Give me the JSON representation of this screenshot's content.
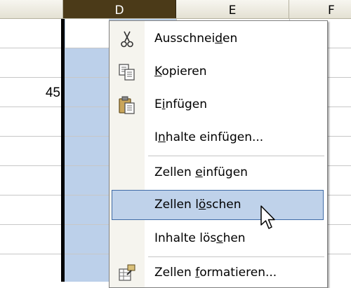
{
  "columns": [
    {
      "id": "c",
      "label": ""
    },
    {
      "id": "d",
      "label": "D"
    },
    {
      "id": "e",
      "label": "E"
    },
    {
      "id": "f",
      "label": "F"
    }
  ],
  "cell_value": "45",
  "menu": {
    "items": [
      {
        "pre": "Ausschnei",
        "key": "d",
        "post": "en",
        "icon": "scissors-icon"
      },
      {
        "pre": "",
        "key": "K",
        "post": "opieren",
        "icon": "copy-icon"
      },
      {
        "pre": "E",
        "key": "i",
        "post": "nfügen",
        "icon": "paste-icon"
      },
      {
        "pre": "I",
        "key": "n",
        "post": "halte einfügen...",
        "icon": ""
      },
      {
        "pre": "Zellen ",
        "key": "e",
        "post": "infügen",
        "icon": ""
      },
      {
        "pre": "Zellen l",
        "key": "ö",
        "post": "schen",
        "icon": "",
        "highlighted": true
      },
      {
        "pre": "Inhalte lös",
        "key": "c",
        "post": "hen",
        "icon": ""
      },
      {
        "pre": "Zellen ",
        "key": "f",
        "post": "ormatieren...",
        "icon": "format-cells-icon"
      }
    ]
  }
}
